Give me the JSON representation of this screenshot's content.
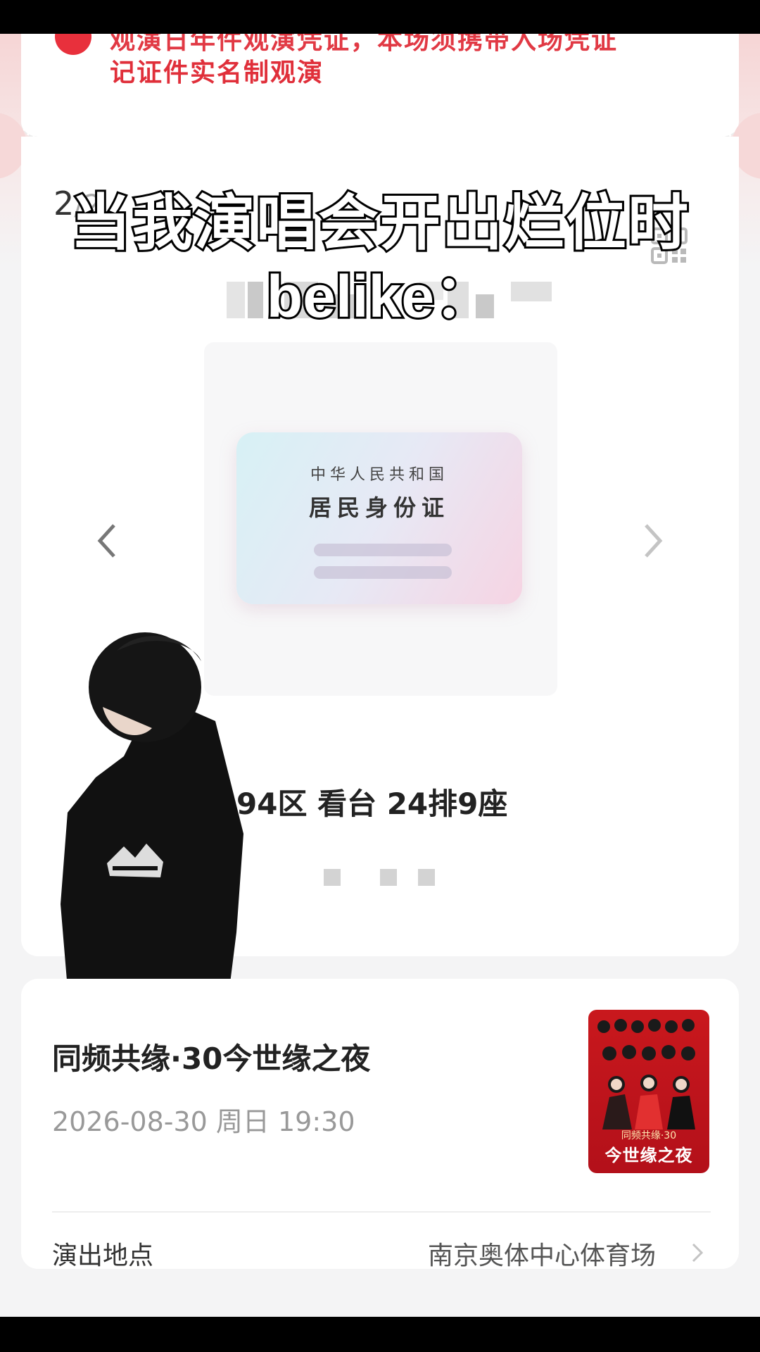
{
  "notice": {
    "line1": "观演日年件观演凭证，本场须携带入场凭证",
    "line2": "记证件实名制观演"
  },
  "ticket": {
    "page_current": "2",
    "page_total": "/2",
    "id_card_country": "中华人民共和国",
    "id_card_type": "居民身份证",
    "seat": "94区 看台 24排9座"
  },
  "overlay": {
    "line1": "当我演唱会开出烂位时",
    "line2": "belike："
  },
  "event": {
    "title": "同频共缘·30今世缘之夜",
    "datetime": "2026-08-30 周日 19:30",
    "poster_title": "今世缘之夜",
    "poster_sub": "同频共缘·30",
    "venue_label": "演出地点",
    "venue_value": "南京奥体中心体育场"
  },
  "icons": {
    "qr": "qr-code-icon",
    "prev": "chevron-left-icon",
    "next": "chevron-right-icon",
    "venue": "chevron-right-icon",
    "notice": "alert-icon"
  },
  "colors": {
    "accent_red": "#e02f3a",
    "card_bg": "#ffffff",
    "page_bg": "#f4f4f5"
  }
}
